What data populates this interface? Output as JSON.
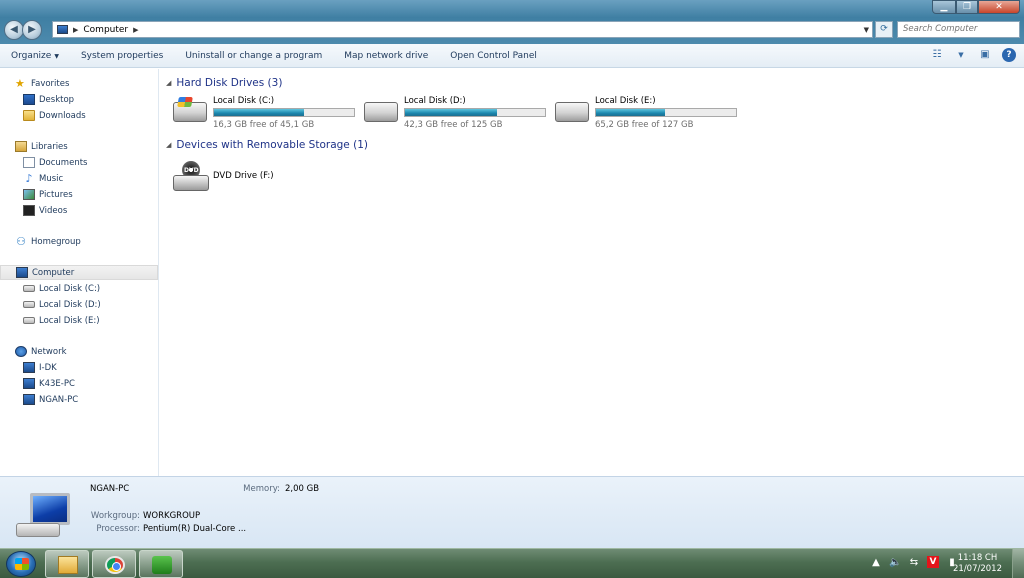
{
  "address": {
    "crumbs": [
      "Computer"
    ]
  },
  "search": {
    "placeholder": "Search Computer"
  },
  "toolbar": {
    "organize": "Organize",
    "system_properties": "System properties",
    "uninstall": "Uninstall or change a program",
    "map_drive": "Map network drive",
    "control_panel": "Open Control Panel"
  },
  "sidebar": {
    "favorites": "Favorites",
    "desktop": "Desktop",
    "downloads": "Downloads",
    "libraries": "Libraries",
    "documents": "Documents",
    "music": "Music",
    "pictures": "Pictures",
    "videos": "Videos",
    "homegroup": "Homegroup",
    "computer": "Computer",
    "disk_c": "Local Disk (C:)",
    "disk_d": "Local Disk (D:)",
    "disk_e": "Local Disk (E:)",
    "network": "Network",
    "net_1": "I-DK",
    "net_2": "K43E-PC",
    "net_3": "NGAN-PC"
  },
  "groups": {
    "hdd": "Hard Disk Drives (3)",
    "removable": "Devices with Removable Storage (1)"
  },
  "drives": [
    {
      "name": "Local Disk (C:)",
      "free": "16,3 GB free of 45,1 GB",
      "used_fraction": 0.64
    },
    {
      "name": "Local Disk (D:)",
      "free": "42,3 GB free of 125 GB",
      "used_fraction": 0.66
    },
    {
      "name": "Local Disk (E:)",
      "free": "65,2 GB free of 127 GB",
      "used_fraction": 0.49
    }
  ],
  "dvd": {
    "name": "DVD Drive (F:)",
    "icon_text": "DVD"
  },
  "details": {
    "name": "NGAN-PC",
    "memory_label": "Memory:",
    "memory": "2,00 GB",
    "workgroup_label": "Workgroup:",
    "workgroup": "WORKGROUP",
    "processor_label": "Processor:",
    "processor": "Pentium(R) Dual-Core ..."
  },
  "clock": {
    "time": "11:18 CH",
    "date": "21/07/2012"
  },
  "tray": {
    "v_label": "V"
  },
  "colors": {
    "accent": "#1e3287",
    "bar_fill": "#1b86ad",
    "taskbar": "#4d6e52"
  }
}
